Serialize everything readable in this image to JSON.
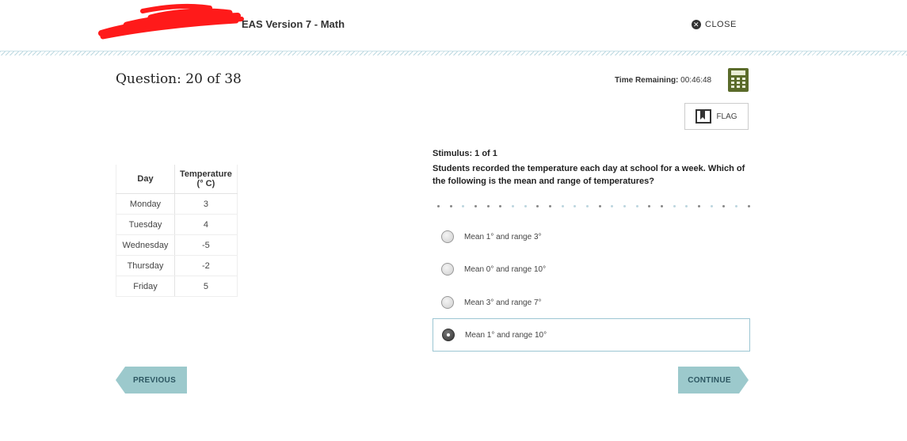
{
  "header": {
    "title": "EAS Version 7 - Math",
    "close_label": "CLOSE"
  },
  "question": {
    "title": "Question: 20 of 38",
    "time_label": "Time Remaining:",
    "time_value": "00:46:48",
    "flag_label": "FLAG"
  },
  "table": {
    "headers": [
      "Day",
      "Temperature",
      "(° C)"
    ],
    "rows": [
      [
        "Monday",
        "3"
      ],
      [
        "Tuesday",
        "4"
      ],
      [
        "Wednesday",
        "-5"
      ],
      [
        "Thursday",
        "-2"
      ],
      [
        "Friday",
        "5"
      ]
    ]
  },
  "stimulus": {
    "label": "Stimulus: 1 of 1",
    "text": "Students recorded the temperature each day at school for a week. Which of the following is the mean and range of temperatures?"
  },
  "options": [
    {
      "label": "Mean 1° and range 3°",
      "selected": false
    },
    {
      "label": "Mean 0° and range 10°",
      "selected": false
    },
    {
      "label": "Mean 3° and range 7°",
      "selected": false
    },
    {
      "label": "Mean 1° and range 10°",
      "selected": true
    }
  ],
  "dot_colors": [
    "#888",
    "#888",
    "#bcd6df",
    "#888",
    "#888",
    "#888",
    "#bcd6df",
    "#bcd6df",
    "#888",
    "#888",
    "#bcd6df",
    "#bcd6df",
    "#bcd6df",
    "#888",
    "#bcd6df",
    "#bcd6df",
    "#bcd6df",
    "#888",
    "#888",
    "#bcd6df",
    "#bcd6df",
    "#888",
    "#bcd6df",
    "#888",
    "#bcd6df",
    "#888"
  ],
  "nav": {
    "previous_label": "PREVIOUS",
    "continue_label": "CONTINUE"
  },
  "colors": {
    "accent": "#9cc9cc",
    "calculator": "#5a6b2a",
    "redaction": "#ff1a1a"
  }
}
